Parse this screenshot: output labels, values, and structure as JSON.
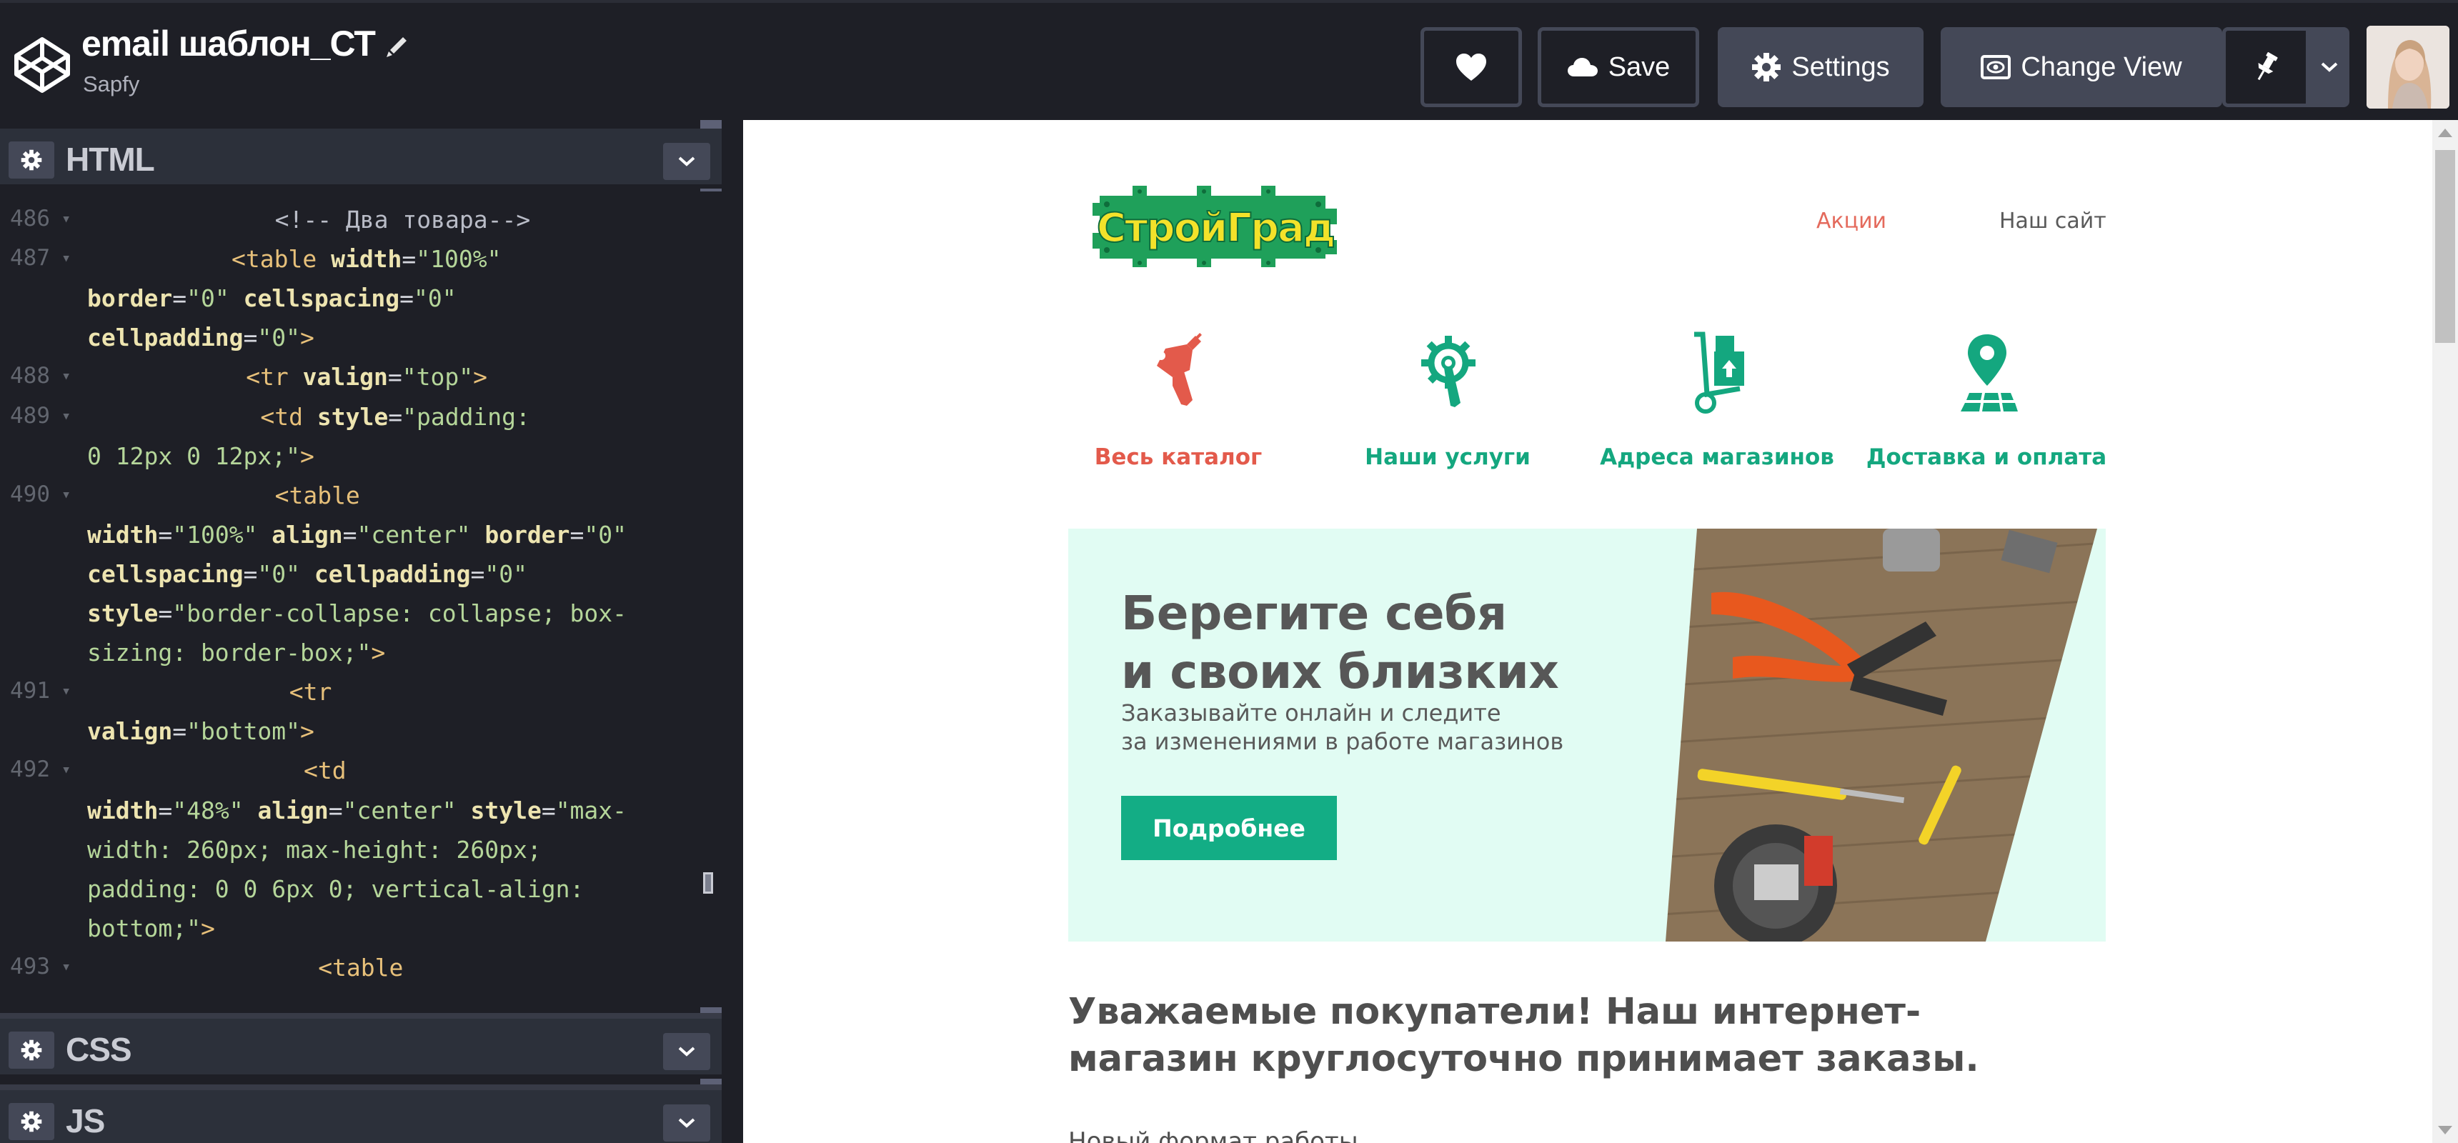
{
  "app": {
    "pen_title": "email шаблон_СТ",
    "author": "Sapfy"
  },
  "toolbar": {
    "save_label": "Save",
    "settings_label": "Settings",
    "change_view_label": "Change View"
  },
  "editor": {
    "panels": [
      {
        "label": "HTML"
      },
      {
        "label": "CSS"
      },
      {
        "label": "JS"
      }
    ],
    "code_lines": [
      {
        "n": "486",
        "indent": 13,
        "parts": [
          [
            "cmt",
            "<!-- Два товара-->"
          ]
        ]
      },
      {
        "n": "487",
        "indent": 10,
        "parts": [
          [
            "tag",
            "<table "
          ],
          [
            "attr",
            "width"
          ],
          [
            "plain",
            "="
          ],
          [
            "val",
            "\"100%\""
          ]
        ]
      },
      {
        "n": "",
        "indent": 0,
        "parts": [
          [
            "attr",
            "border"
          ],
          [
            "plain",
            "="
          ],
          [
            "val",
            "\"0\" "
          ],
          [
            "attr",
            "cellspacing"
          ],
          [
            "plain",
            "="
          ],
          [
            "val",
            "\"0\""
          ]
        ]
      },
      {
        "n": "",
        "indent": 0,
        "parts": [
          [
            "attr",
            "cellpadding"
          ],
          [
            "plain",
            "="
          ],
          [
            "val",
            "\"0\""
          ],
          [
            "tag",
            ">"
          ]
        ]
      },
      {
        "n": "488",
        "indent": 11,
        "parts": [
          [
            "tag",
            "<tr "
          ],
          [
            "attr",
            "valign"
          ],
          [
            "plain",
            "="
          ],
          [
            "val",
            "\"top\""
          ],
          [
            "tag",
            ">"
          ]
        ]
      },
      {
        "n": "489",
        "indent": 12,
        "parts": [
          [
            "tag",
            "<td "
          ],
          [
            "attr",
            "style"
          ],
          [
            "plain",
            "="
          ],
          [
            "val",
            "\"padding:"
          ]
        ]
      },
      {
        "n": "",
        "indent": 0,
        "parts": [
          [
            "val",
            "0 12px 0 12px;\""
          ],
          [
            "tag",
            ">"
          ]
        ]
      },
      {
        "n": "490",
        "indent": 13,
        "parts": [
          [
            "tag",
            "<table"
          ]
        ]
      },
      {
        "n": "",
        "indent": 0,
        "parts": [
          [
            "attr",
            "width"
          ],
          [
            "plain",
            "="
          ],
          [
            "val",
            "\"100%\" "
          ],
          [
            "attr",
            "align"
          ],
          [
            "plain",
            "="
          ],
          [
            "val",
            "\"center\" "
          ],
          [
            "attr",
            "border"
          ],
          [
            "plain",
            "="
          ],
          [
            "val",
            "\"0\""
          ]
        ]
      },
      {
        "n": "",
        "indent": 0,
        "parts": [
          [
            "attr",
            "cellspacing"
          ],
          [
            "plain",
            "="
          ],
          [
            "val",
            "\"0\" "
          ],
          [
            "attr",
            "cellpadding"
          ],
          [
            "plain",
            "="
          ],
          [
            "val",
            "\"0\""
          ]
        ]
      },
      {
        "n": "",
        "indent": 0,
        "parts": [
          [
            "attr",
            "style"
          ],
          [
            "plain",
            "="
          ],
          [
            "val",
            "\"border-collapse: collapse; box-"
          ]
        ]
      },
      {
        "n": "",
        "indent": 0,
        "parts": [
          [
            "val",
            "sizing: border-box;\""
          ],
          [
            "tag",
            ">"
          ]
        ]
      },
      {
        "n": "491",
        "indent": 14,
        "parts": [
          [
            "tag",
            "<tr"
          ]
        ]
      },
      {
        "n": "",
        "indent": 0,
        "parts": [
          [
            "attr",
            "valign"
          ],
          [
            "plain",
            "="
          ],
          [
            "val",
            "\"bottom\""
          ],
          [
            "tag",
            ">"
          ]
        ]
      },
      {
        "n": "492",
        "indent": 15,
        "parts": [
          [
            "tag",
            "<td"
          ]
        ]
      },
      {
        "n": "",
        "indent": 0,
        "parts": [
          [
            "attr",
            "width"
          ],
          [
            "plain",
            "="
          ],
          [
            "val",
            "\"48%\" "
          ],
          [
            "attr",
            "align"
          ],
          [
            "plain",
            "="
          ],
          [
            "val",
            "\"center\" "
          ],
          [
            "attr",
            "style"
          ],
          [
            "plain",
            "="
          ],
          [
            "val",
            "\"max-"
          ]
        ]
      },
      {
        "n": "",
        "indent": 0,
        "parts": [
          [
            "val",
            "width: 260px; max-height: 260px;"
          ]
        ]
      },
      {
        "n": "",
        "indent": 0,
        "parts": [
          [
            "val",
            "padding: 0 0 6px 0; vertical-align:"
          ]
        ]
      },
      {
        "n": "",
        "indent": 0,
        "parts": [
          [
            "val",
            "bottom;\""
          ],
          [
            "tag",
            ">"
          ]
        ]
      },
      {
        "n": "493",
        "indent": 16,
        "parts": [
          [
            "tag",
            "<table"
          ]
        ]
      }
    ]
  },
  "preview": {
    "nav_links": [
      {
        "label": "Акции",
        "color": "#e46a5c"
      },
      {
        "label": "Наш сайт",
        "color": "#5a5a5a"
      }
    ],
    "categories": [
      {
        "label": "Весь каталог",
        "icon": "drill-icon",
        "color": "#e35a4b"
      },
      {
        "label": "Наши услуги",
        "icon": "gear-wrench-icon",
        "color": "#14a77f"
      },
      {
        "label": "Адреса магазинов",
        "icon": "hand-truck-icon",
        "color": "#14a77f"
      },
      {
        "label": "Доставка и оплата",
        "icon": "map-pin-icon",
        "color": "#14a77f"
      }
    ],
    "banner": {
      "heading_line1": "Берегите себя",
      "heading_line2": "и своих близких",
      "text_line1": "Заказывайте онлайн и следите",
      "text_line2": "за изменениями в работе магазинов",
      "button_label": "Подробнее"
    },
    "notice_line1": "Уважаемые покупатели! Наш интернет-",
    "notice_line2": "магазин круглосуточно принимает заказы.",
    "notice_more": "Новый формат работы"
  },
  "colors": {
    "accent_green": "#13ad85",
    "accent_red": "#e46a5c",
    "banner_bg": "#e1fcf3",
    "logo_green": "#1fa05a",
    "logo_yellow": "#f3e22a"
  }
}
